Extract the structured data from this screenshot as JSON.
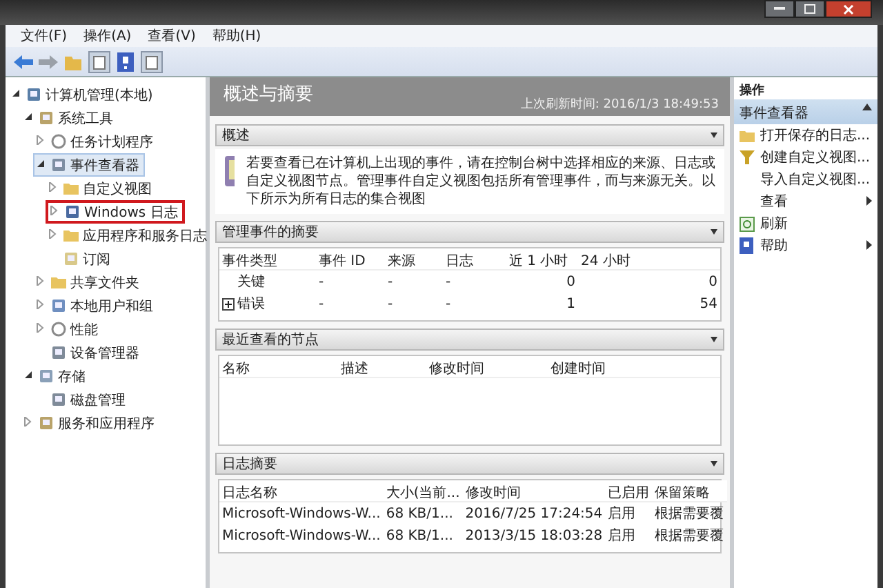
{
  "menu": [
    "文件(F)",
    "操作(A)",
    "查看(V)",
    "帮助(H)"
  ],
  "toolbar": [
    {
      "kind": "back"
    },
    {
      "kind": "forward"
    },
    {
      "kind": "folder"
    },
    {
      "kind": "pane"
    },
    {
      "kind": "help"
    },
    {
      "kind": "pane"
    }
  ],
  "tree": [
    {
      "label": "计算机管理(本地)",
      "kind": "computer",
      "expanded": true,
      "selected": false,
      "children": [
        {
          "label": "系统工具",
          "kind": "tools",
          "expanded": true,
          "selected": false,
          "children": [
            {
              "label": "任务计划程序",
              "kind": "clock",
              "expanded": false,
              "selected": false
            },
            {
              "label": "事件查看器",
              "kind": "viewer",
              "expanded": true,
              "selected": true,
              "children": [
                {
                  "label": "自定义视图",
                  "kind": "folder",
                  "expanded": false,
                  "selected": false
                },
                {
                  "label": "Windows 日志",
                  "kind": "log",
                  "expanded": false,
                  "selected": false,
                  "marked": true
                },
                {
                  "label": "应用程序和服务日志",
                  "kind": "folder",
                  "expanded": false,
                  "selected": false
                },
                {
                  "label": "订阅",
                  "kind": "doc",
                  "selected": false
                }
              ]
            },
            {
              "label": "共享文件夹",
              "kind": "folder",
              "expanded": false,
              "selected": false
            },
            {
              "label": "本地用户和组",
              "kind": "users",
              "expanded": false,
              "selected": false
            },
            {
              "label": "性能",
              "kind": "clock",
              "expanded": false,
              "selected": false
            },
            {
              "label": "设备管理器",
              "kind": "device",
              "selected": false
            }
          ]
        },
        {
          "label": "存储",
          "kind": "storage",
          "expanded": true,
          "selected": false,
          "children": [
            {
              "label": "磁盘管理",
              "kind": "device",
              "selected": false
            }
          ]
        },
        {
          "label": "服务和应用程序",
          "kind": "tools",
          "expanded": false,
          "selected": false
        }
      ]
    }
  ],
  "center": {
    "title": "概述与摘要",
    "refreshed": "上次刷新时间: 2016/1/3 18:49:53",
    "overview": {
      "title": "概述",
      "text": "若要查看已在计算机上出现的事件，请在控制台树中选择相应的来源、日志或自定义视图节点。管理事件自定义视图包括所有管理事件，而与来源无关。以下所示为所有日志的集合视图"
    },
    "sections": [
      {
        "title": "管理事件的摘要",
        "columns": [
          "事件类型",
          "事件 ID",
          "来源",
          "日志",
          "近 1 小时",
          "24 小时"
        ],
        "rows": [
          {
            "expandable": false,
            "cells": [
              "关键",
              "-",
              "-",
              "-",
              "0",
              "0"
            ]
          },
          {
            "expandable": true,
            "cells": [
              "错误",
              "-",
              "-",
              "-",
              "1",
              "54"
            ]
          }
        ]
      },
      {
        "title": "最近查看的节点",
        "columns": [
          "名称",
          "描述",
          "修改时间",
          "创建时间"
        ]
      },
      {
        "title": "日志摘要",
        "columns": [
          "日志名称",
          "大小(当前...",
          "修改时间",
          "已启用",
          "保留策略"
        ],
        "rows": [
          {
            "cells": [
              "Microsoft-Windows-W...",
              "68 KB/1...",
              "2016/7/25 17:24:54",
              "启用",
              "根据需要覆"
            ]
          },
          {
            "cells": [
              "Microsoft-Windows-W...",
              "68 KB/1...",
              "2013/3/15 18:03:28",
              "启用",
              "根据需要覆"
            ]
          }
        ]
      }
    ]
  },
  "actions": {
    "title": "操作",
    "group": "事件查看器",
    "items": [
      {
        "label": "打开保存的日志...",
        "kind": "folder",
        "submenu": false
      },
      {
        "label": "创建自定义视图...",
        "kind": "filter",
        "submenu": false
      },
      {
        "label": "导入自定义视图...",
        "kind": "plain",
        "submenu": false
      },
      {
        "label": "查看",
        "kind": "plain",
        "submenu": true
      },
      {
        "label": "刷新",
        "kind": "refresh",
        "submenu": false
      },
      {
        "label": "帮助",
        "kind": "help",
        "submenu": true
      }
    ]
  }
}
